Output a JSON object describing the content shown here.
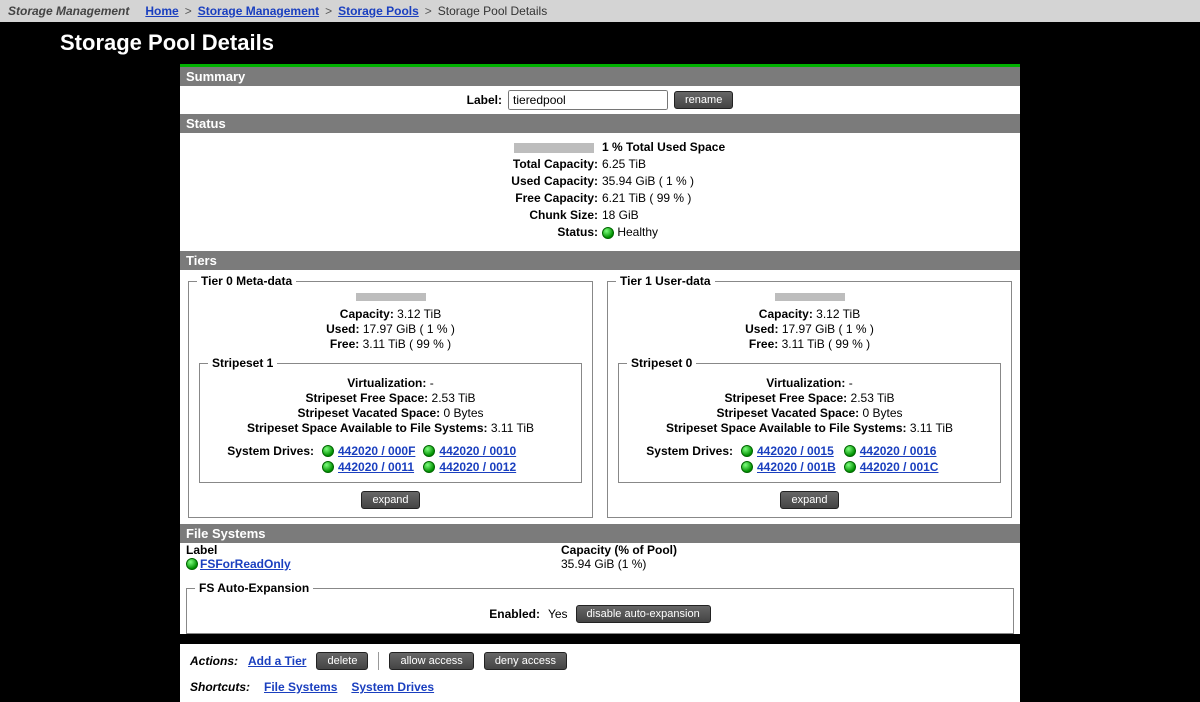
{
  "app_title": "Storage Management",
  "breadcrumb": {
    "home": "Home",
    "l1": "Storage Management",
    "l2": "Storage Pools",
    "current": "Storage Pool Details"
  },
  "page_title": "Storage Pool Details",
  "sections": {
    "summary": "Summary",
    "status": "Status",
    "tiers": "Tiers",
    "filesystems": "File Systems"
  },
  "summary": {
    "label_text": "Label:",
    "label_value": "tieredpool",
    "rename_btn": "rename"
  },
  "status": {
    "used_pct_label": "1 % Total Used Space",
    "total_capacity_label": "Total Capacity:",
    "total_capacity": "6.25 TiB",
    "used_capacity_label": "Used Capacity:",
    "used_capacity": "35.94 GiB ( 1 % )",
    "free_capacity_label": "Free Capacity:",
    "free_capacity": "6.21 TiB ( 99 % )",
    "chunk_size_label": "Chunk Size:",
    "chunk_size": "18 GiB",
    "status_label": "Status:",
    "status_value": "Healthy"
  },
  "tiers": [
    {
      "legend": "Tier 0 Meta-data",
      "capacity_label": "Capacity:",
      "capacity": "3.12 TiB",
      "used_label": "Used:",
      "used": "17.97 GiB ( 1 % )",
      "free_label": "Free:",
      "free": "3.11 TiB ( 99 % )",
      "stripeset": {
        "legend": "Stripeset 1",
        "virt_label": "Virtualization:",
        "virt": "-",
        "free_label": "Stripeset Free Space:",
        "free": "2.53 TiB",
        "vacated_label": "Stripeset Vacated Space:",
        "vacated": "0 Bytes",
        "avail_label": "Stripeset Space Available to File Systems:",
        "avail": "3.11 TiB",
        "drives_label": "System Drives:",
        "drives": [
          [
            "442020 / 000F",
            "442020 / 0010"
          ],
          [
            "442020 / 0011",
            "442020 / 0012"
          ]
        ]
      },
      "expand_btn": "expand"
    },
    {
      "legend": "Tier 1 User-data",
      "capacity_label": "Capacity:",
      "capacity": "3.12 TiB",
      "used_label": "Used:",
      "used": "17.97 GiB ( 1 % )",
      "free_label": "Free:",
      "free": "3.11 TiB ( 99 % )",
      "stripeset": {
        "legend": "Stripeset 0",
        "virt_label": "Virtualization:",
        "virt": "-",
        "free_label": "Stripeset Free Space:",
        "free": "2.53 TiB",
        "vacated_label": "Stripeset Vacated Space:",
        "vacated": "0 Bytes",
        "avail_label": "Stripeset Space Available to File Systems:",
        "avail": "3.11 TiB",
        "drives_label": "System Drives:",
        "drives": [
          [
            "442020 / 0015",
            "442020 / 0016"
          ],
          [
            "442020 / 001B",
            "442020 / 001C"
          ]
        ]
      },
      "expand_btn": "expand"
    }
  ],
  "filesystems": {
    "col1": "Label",
    "col2": "Capacity (% of Pool)",
    "row": {
      "name": "FSForReadOnly",
      "capacity": "35.94 GiB (1 %)"
    }
  },
  "autoexp": {
    "legend": "FS Auto-Expansion",
    "enabled_label": "Enabled:",
    "enabled_value": "Yes",
    "disable_btn": "disable auto-expansion"
  },
  "actions": {
    "label": "Actions:",
    "add_tier": "Add a Tier",
    "delete": "delete",
    "allow": "allow access",
    "deny": "deny access"
  },
  "shortcuts": {
    "label": "Shortcuts:",
    "fs": "File Systems",
    "sd": "System Drives"
  }
}
